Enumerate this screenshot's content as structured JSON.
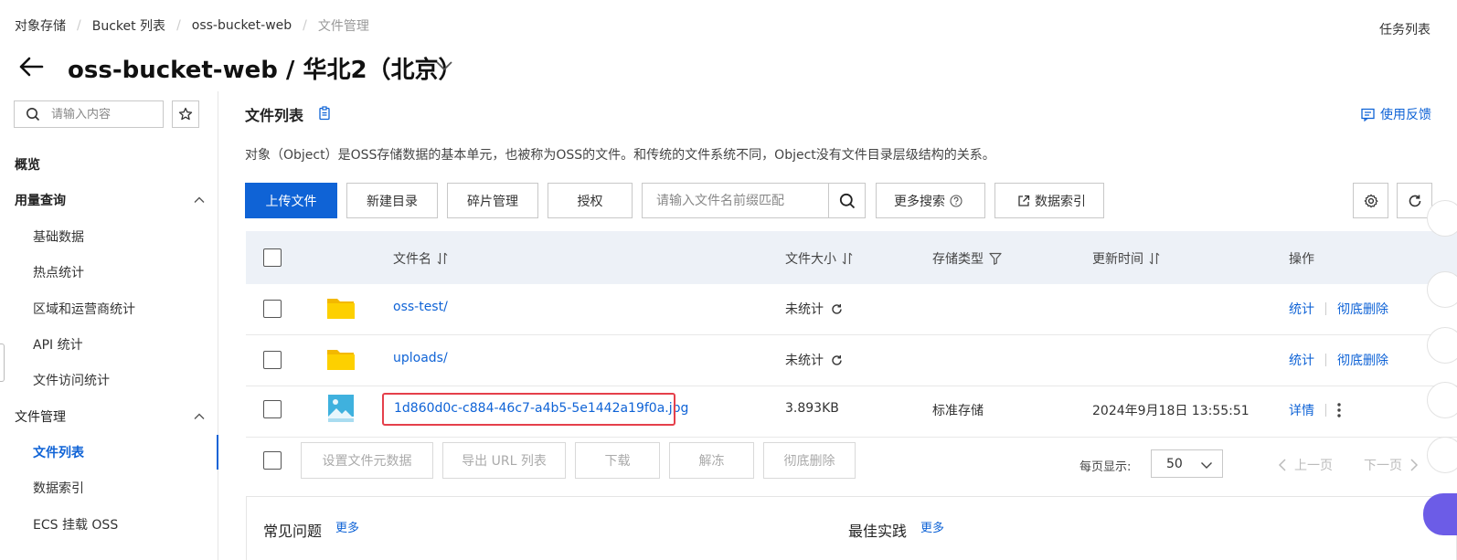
{
  "breadcrumb": {
    "items": [
      "对象存储",
      "Bucket 列表",
      "oss-bucket-web"
    ],
    "current": "文件管理"
  },
  "task_list_label": "任务列表",
  "title": "oss-bucket-web / 华北2（北京）",
  "sidebar": {
    "search_placeholder": "请输入内容",
    "items": [
      {
        "label": "概览",
        "type": "group"
      },
      {
        "label": "用量查询",
        "type": "group",
        "expanded": true
      },
      {
        "label": "基础数据",
        "type": "sub"
      },
      {
        "label": "热点统计",
        "type": "sub"
      },
      {
        "label": "区域和运营商统计",
        "type": "sub"
      },
      {
        "label": "API 统计",
        "type": "sub"
      },
      {
        "label": "文件访问统计",
        "type": "sub"
      },
      {
        "label": "文件管理",
        "type": "group",
        "expanded": true
      },
      {
        "label": "文件列表",
        "type": "sub",
        "active": true
      },
      {
        "label": "数据索引",
        "type": "sub"
      },
      {
        "label": "ECS 挂载 OSS",
        "type": "sub"
      }
    ]
  },
  "main": {
    "title": "文件列表",
    "feedback": "使用反馈",
    "description": "对象（Object）是OSS存储数据的基本单元，也被称为OSS的文件。和传统的文件系统不同，Object没有文件目录层级结构的关系。"
  },
  "toolbar": {
    "upload": "上传文件",
    "new_dir": "新建目录",
    "fragments": "碎片管理",
    "authorize": "授权",
    "search_placeholder": "请输入文件名前缀匹配",
    "more_search": "更多搜索",
    "data_index": "数据索引"
  },
  "table": {
    "headers": {
      "name": "文件名",
      "size": "文件大小",
      "storage": "存储类型",
      "updated": "更新时间",
      "ops": "操作"
    },
    "rows": [
      {
        "type": "folder",
        "name": "oss-test/",
        "size": "未统计",
        "storage": "",
        "updated": "",
        "ops": [
          "统计",
          "彻底删除"
        ]
      },
      {
        "type": "folder",
        "name": "uploads/",
        "size": "未统计",
        "storage": "",
        "updated": "",
        "ops": [
          "统计",
          "彻底删除"
        ]
      },
      {
        "type": "image",
        "name": "1d860d0c-c884-46c7-a4b5-5e1442a19f0a.jpg",
        "size": "3.893KB",
        "storage": "标准存储",
        "updated": "2024年9月18日 13:55:51",
        "ops": [
          "详情"
        ],
        "highlighted": true
      }
    ]
  },
  "batch": {
    "set_meta": "设置文件元数据",
    "export_url": "导出 URL 列表",
    "download": "下载",
    "unfreeze": "解冻",
    "delete": "彻底删除"
  },
  "pagination": {
    "per_page_label": "每页显示:",
    "per_page_value": "50",
    "prev": "上一页",
    "next": "下一页"
  },
  "cards": {
    "faq_title": "常见问题",
    "faq_more": "更多",
    "best_title": "最佳实践",
    "best_more": "更多"
  },
  "colors": {
    "primary": "#0f63d6",
    "highlight_border": "#e5404b",
    "header_bg": "#edf1f7",
    "folder": "#f6c000"
  }
}
